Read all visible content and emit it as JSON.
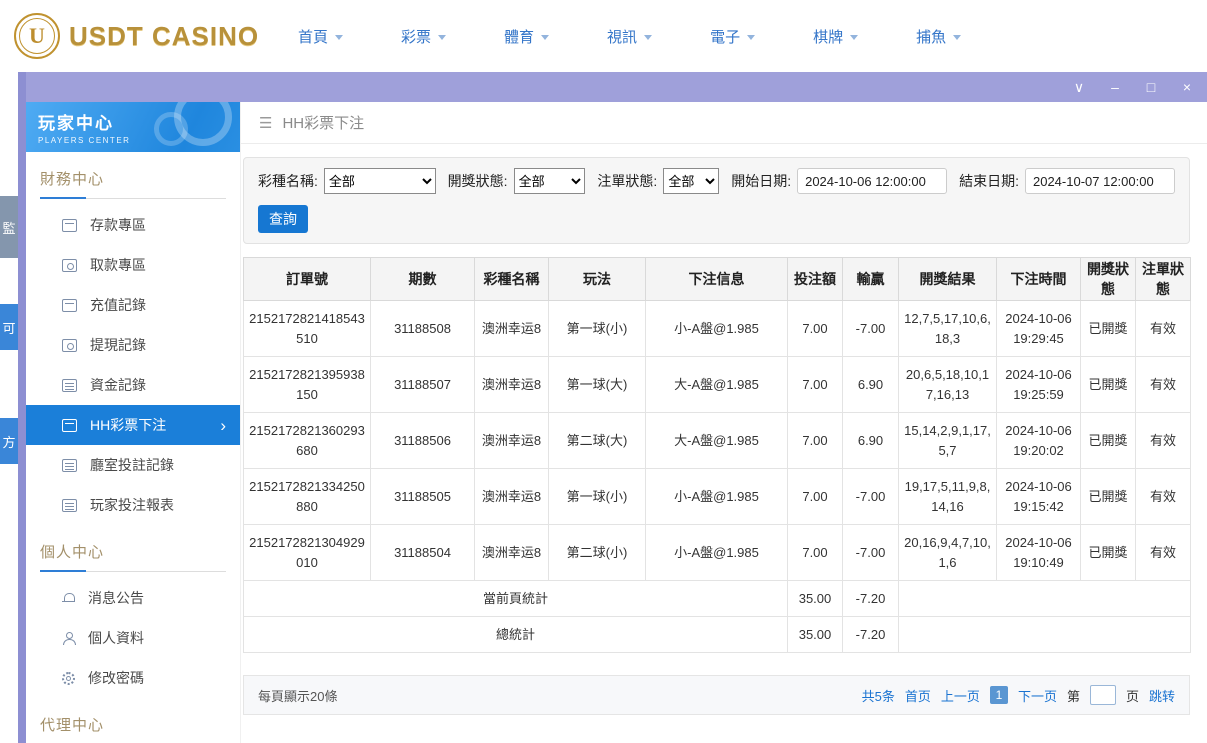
{
  "brand": {
    "name": "USDT CASINO",
    "logo_letter": "U"
  },
  "top_nav": {
    "items": [
      {
        "label": "首頁"
      },
      {
        "label": "彩票"
      },
      {
        "label": "體育"
      },
      {
        "label": "視訊"
      },
      {
        "label": "電子"
      },
      {
        "label": "棋牌"
      },
      {
        "label": "捕魚"
      }
    ]
  },
  "window_controls": {
    "collapse": "∨",
    "minimize": "–",
    "maximize": "□",
    "close": "×"
  },
  "icons": {
    "hamburger": "☰",
    "active_chevron": "›"
  },
  "edge_widget": {
    "items": [
      {
        "label": "監"
      },
      {
        "label": "可"
      },
      {
        "label": "方"
      }
    ]
  },
  "sidebar": {
    "title": "玩家中心",
    "subtitle": "PLAYERS CENTER",
    "sections": [
      {
        "label": "財務中心",
        "items": [
          {
            "label": "存款專區"
          },
          {
            "label": "取款專區"
          },
          {
            "label": "充值記錄"
          },
          {
            "label": "提現記錄"
          },
          {
            "label": "資金記錄"
          },
          {
            "label": "HH彩票下注",
            "active": true
          },
          {
            "label": "廳室投註記錄"
          },
          {
            "label": "玩家投注報表"
          }
        ]
      },
      {
        "label": "個人中心",
        "items": [
          {
            "label": "消息公告"
          },
          {
            "label": "個人資料"
          },
          {
            "label": "修改密碼"
          }
        ]
      },
      {
        "label": "代理中心",
        "items": []
      }
    ]
  },
  "page": {
    "title": "HH彩票下注"
  },
  "filters": {
    "lottery_label": "彩種名稱:",
    "lottery_value": "全部",
    "draw_status_label": "開獎狀態:",
    "draw_status_value": "全部",
    "order_status_label": "注單狀態:",
    "order_status_value": "全部",
    "start_label": "開始日期:",
    "start_value": "2024-10-06 12:00:00",
    "end_label": "結束日期:",
    "end_value": "2024-10-07 12:00:00",
    "search_button": "查詢"
  },
  "table": {
    "headers": [
      "訂單號",
      "期數",
      "彩種名稱",
      "玩法",
      "下注信息",
      "投注額",
      "輸贏",
      "開獎結果",
      "下注時間",
      "開獎狀態",
      "注單狀態"
    ],
    "rows": [
      {
        "order_id": "2152172821418543510",
        "period": "31188508",
        "lottery": "澳洲幸运8",
        "play": "第一球(小)",
        "bet_info": "小-A盤@1.985",
        "bet_amount": "7.00",
        "win_loss": "-7.00",
        "draw_result": "12,7,5,17,10,6,18,3",
        "bet_time": "2024-10-06 19:29:45",
        "draw_status": "已開獎",
        "order_status": "有效"
      },
      {
        "order_id": "2152172821395938150",
        "period": "31188507",
        "lottery": "澳洲幸运8",
        "play": "第一球(大)",
        "bet_info": "大-A盤@1.985",
        "bet_amount": "7.00",
        "win_loss": "6.90",
        "draw_result": "20,6,5,18,10,17,16,13",
        "bet_time": "2024-10-06 19:25:59",
        "draw_status": "已開獎",
        "order_status": "有效"
      },
      {
        "order_id": "2152172821360293680",
        "period": "31188506",
        "lottery": "澳洲幸运8",
        "play": "第二球(大)",
        "bet_info": "大-A盤@1.985",
        "bet_amount": "7.00",
        "win_loss": "6.90",
        "draw_result": "15,14,2,9,1,17,5,7",
        "bet_time": "2024-10-06 19:20:02",
        "draw_status": "已開獎",
        "order_status": "有效"
      },
      {
        "order_id": "2152172821334250880",
        "period": "31188505",
        "lottery": "澳洲幸运8",
        "play": "第一球(小)",
        "bet_info": "小-A盤@1.985",
        "bet_amount": "7.00",
        "win_loss": "-7.00",
        "draw_result": "19,17,5,11,9,8,14,16",
        "bet_time": "2024-10-06 19:15:42",
        "draw_status": "已開獎",
        "order_status": "有效"
      },
      {
        "order_id": "2152172821304929010",
        "period": "31188504",
        "lottery": "澳洲幸运8",
        "play": "第二球(小)",
        "bet_info": "小-A盤@1.985",
        "bet_amount": "7.00",
        "win_loss": "-7.00",
        "draw_result": "20,16,9,4,7,10,1,6",
        "bet_time": "2024-10-06 19:10:49",
        "draw_status": "已開獎",
        "order_status": "有效"
      }
    ],
    "page_summary": {
      "label": "當前頁統計",
      "bet_amount": "35.00",
      "win_loss": "-7.20"
    },
    "total_summary": {
      "label": "總統計",
      "bet_amount": "35.00",
      "win_loss": "-7.20"
    }
  },
  "pagination": {
    "per_page": "每頁顯示20條",
    "total": "共5条",
    "first": "首页",
    "prev": "上一页",
    "current": "1",
    "next": "下一页",
    "page_prefix": "第",
    "page_suffix": "页",
    "jump": "跳转"
  },
  "colors": {
    "accent_blue": "#1b7fd9",
    "titlebar_purple": "#9fa0da",
    "brand_gold": "#b8913a",
    "link_blue": "#1a73d1"
  }
}
